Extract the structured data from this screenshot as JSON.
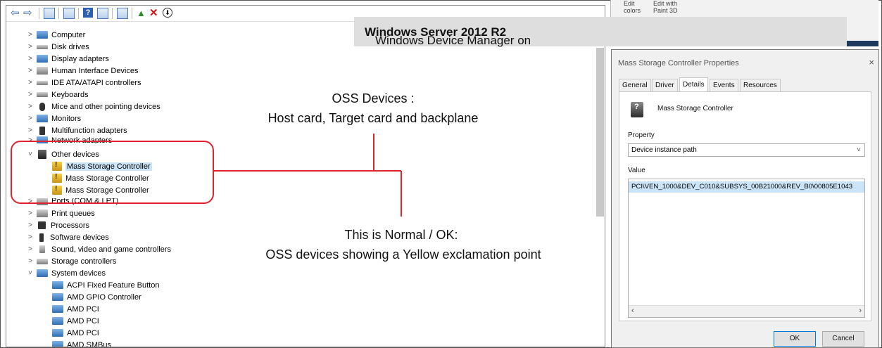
{
  "banner": {
    "prefix": "Windows Device Manager  on ",
    "bold": "Windows Server 2012 R2"
  },
  "toolbar": {
    "icons": [
      "back-arrow-icon",
      "forward-arrow-icon",
      "properties-icon",
      "console-icon",
      "help-icon",
      "view-icon",
      "monitor-icon",
      "enable-device-icon",
      "uninstall-icon",
      "update-driver-icon"
    ]
  },
  "tree": {
    "items": [
      {
        "label": "Computer",
        "expanded": false
      },
      {
        "label": "Disk drives",
        "expanded": false
      },
      {
        "label": "Display adapters",
        "expanded": false
      },
      {
        "label": "Human Interface Devices",
        "expanded": false
      },
      {
        "label": "IDE ATA/ATAPI controllers",
        "expanded": false
      },
      {
        "label": "Keyboards",
        "expanded": false
      },
      {
        "label": "Mice and other pointing devices",
        "expanded": false
      },
      {
        "label": "Monitors",
        "expanded": false
      },
      {
        "label": "Multifunction adapters",
        "expanded": false
      },
      {
        "label": "Network adapters",
        "expanded": false
      },
      {
        "label": "Other devices",
        "expanded": true
      },
      {
        "label": "Mass Storage Controller",
        "child": true,
        "warning": true,
        "selected": true
      },
      {
        "label": "Mass Storage Controller",
        "child": true,
        "warning": true
      },
      {
        "label": "Mass Storage Controller",
        "child": true,
        "warning": true
      },
      {
        "label": "Ports (COM & LPT)",
        "expanded": false
      },
      {
        "label": "Print queues",
        "expanded": false
      },
      {
        "label": "Processors",
        "expanded": false
      },
      {
        "label": "Software devices",
        "expanded": false
      },
      {
        "label": "Sound, video and game controllers",
        "expanded": false
      },
      {
        "label": "Storage controllers",
        "expanded": false
      },
      {
        "label": "System devices",
        "expanded": true
      },
      {
        "label": "ACPI Fixed Feature Button",
        "child": true
      },
      {
        "label": "AMD GPIO Controller",
        "child": true
      },
      {
        "label": "AMD PCI",
        "child": true
      },
      {
        "label": "AMD PCI",
        "child": true
      },
      {
        "label": "AMD PCI",
        "child": true
      },
      {
        "label": "AMD SMBus",
        "child": true
      }
    ]
  },
  "annotations": {
    "oss_line1": "OSS Devices :",
    "oss_line2": "Host card, Target card and backplane",
    "normal_line1": "This is Normal / OK:",
    "normal_line2": "OSS devices showing a Yellow exclamation point"
  },
  "behind_window": {
    "labels": [
      "Edit",
      "Edit with"
    ],
    "sublabels": [
      "colors",
      "Paint 3D"
    ]
  },
  "dialog": {
    "title": "Mass Storage Controller Properties",
    "close": "×",
    "tabs": [
      "General",
      "Driver",
      "Details",
      "Events",
      "Resources"
    ],
    "active_tab": "Details",
    "device_name": "Mass Storage Controller",
    "property_label": "Property",
    "property_value": "Device instance path",
    "value_label": "Value",
    "value_text": "PCI\\VEN_1000&DEV_C010&SUBSYS_00B21000&REV_B0\\00805E1043",
    "ok": "OK",
    "cancel": "Cancel"
  },
  "colors": {
    "highlight": "#e0242e",
    "selection": "#cce4f7",
    "banner_bg": "#dedede"
  }
}
